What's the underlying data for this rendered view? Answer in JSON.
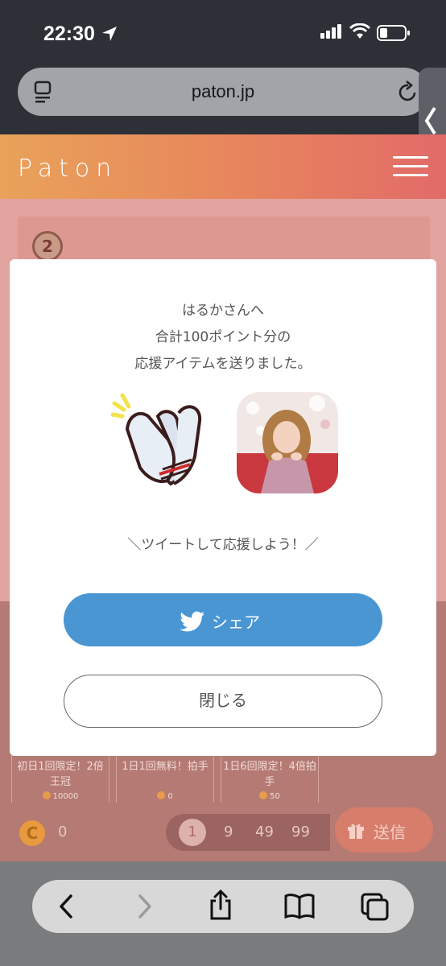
{
  "status": {
    "time": "22:30"
  },
  "browser": {
    "url": "paton.jp"
  },
  "site": {
    "logo": "Paton"
  },
  "background": {
    "rank": "2",
    "cards": [
      {
        "title": "初日1回限定！2倍王冠",
        "cost": "10000"
      },
      {
        "title": "1日1回無料！拍手",
        "cost": "0"
      },
      {
        "title": "1日6回限定！4倍拍手",
        "cost": "50"
      }
    ],
    "coin_symbol": "C",
    "coin_balance": "0",
    "quantities": [
      "1",
      "9",
      "49",
      "99"
    ],
    "selected_quantity": "1",
    "send_label": "送信"
  },
  "dialog": {
    "line1": "はるかさんへ",
    "line2": "合計100ポイント分の",
    "line3": "応援アイテムを送りました。",
    "tweet_prompt": "＼ツイートして応援しよう！／",
    "share_label": "シェア",
    "close_label": "閉じる"
  },
  "colors": {
    "share": "#4a96d3",
    "header_start": "#e9a25a",
    "header_end": "#e26b68"
  }
}
